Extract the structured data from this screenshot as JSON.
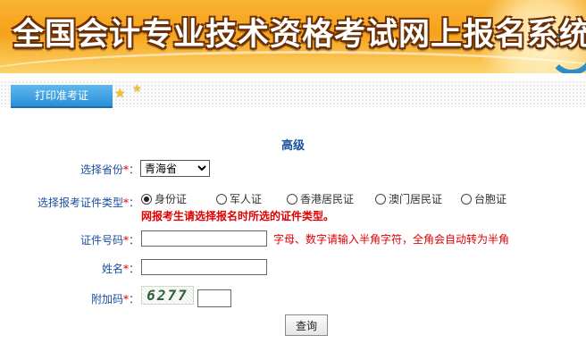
{
  "header": {
    "title": "全国会计专业技术资格考试网上报名系统"
  },
  "nav": {
    "tab_label": "打印准考证"
  },
  "form": {
    "section_title": "高级",
    "required_mark": "*",
    "province": {
      "label": "选择省份",
      "colon": "：",
      "selected": "青海省"
    },
    "id_type": {
      "label": "选择报考证件类型",
      "colon": "：",
      "options": [
        "身份证",
        "军人证",
        "香港居民证",
        "澳门居民证",
        "台胞证"
      ],
      "selected": "身份证",
      "warning": "网报考生请选择报名时所选的证件类型。"
    },
    "id_number": {
      "label": "证件号码",
      "colon": "：",
      "value": "",
      "hint": "字母、数字请输入半角字符，全角会自动转为半角"
    },
    "name": {
      "label": "姓名",
      "colon": "：",
      "value": ""
    },
    "captcha": {
      "label": "附加码",
      "colon": "：",
      "image_text": "6277",
      "value": ""
    },
    "submit_label": "查询"
  }
}
